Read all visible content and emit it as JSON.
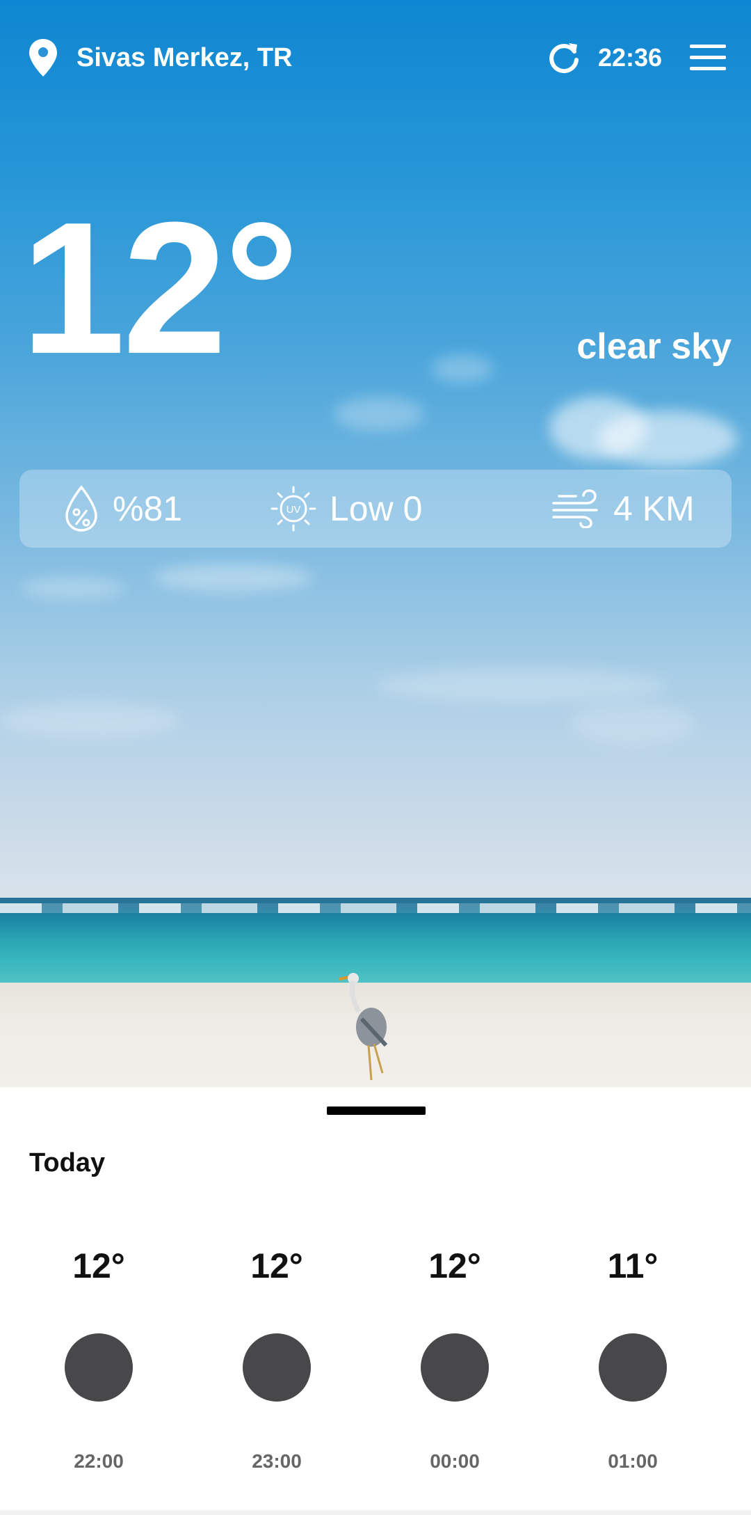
{
  "header": {
    "location": "Sivas Merkez, TR",
    "time": "22:36",
    "location_icon": "map-pin-icon",
    "refresh_icon": "refresh-icon",
    "menu_icon": "hamburger-menu-icon"
  },
  "current": {
    "temperature": "12°",
    "condition": "clear sky"
  },
  "stats": {
    "humidity": "%81",
    "uv": "Low 0",
    "wind": "4 KM"
  },
  "forecast": {
    "title": "Today",
    "hours": [
      {
        "temp": "12°",
        "time": "22:00"
      },
      {
        "temp": "12°",
        "time": "23:00"
      },
      {
        "temp": "12°",
        "time": "00:00"
      },
      {
        "temp": "11°",
        "time": "01:00"
      }
    ]
  },
  "colors": {
    "sky_top": "#0e86d1",
    "icon_placeholder": "#48484a"
  }
}
